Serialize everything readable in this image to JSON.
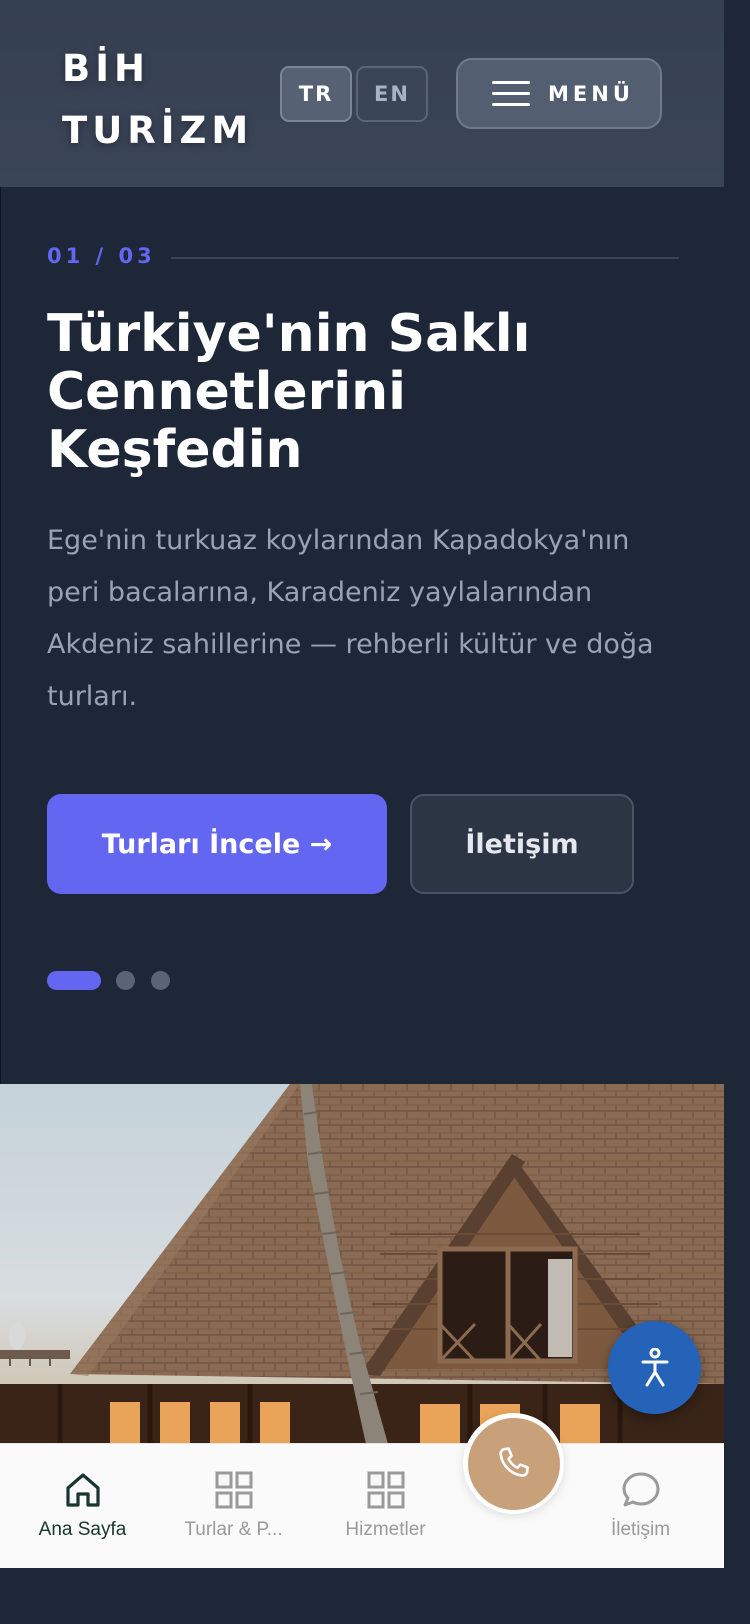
{
  "header": {
    "logo_line1": "BİH",
    "logo_line2": "TURİZM",
    "lang_tr": "TR",
    "lang_en": "EN",
    "menu_label": "MENÜ"
  },
  "hero": {
    "counter": "01 / 03",
    "title_line1": "Türkiye'nin Saklı",
    "title_line2": "Cennetlerini",
    "title_line3": "Keşfedin",
    "description": "Ege'nin turkuaz koylarından Kapadokya'nın peri bacalarına, Karadeniz yaylalarından Akdeniz sahillerine — rehberli kültür ve doğa turları.",
    "primary_button": "Turları İncele →",
    "secondary_button": "İletişim",
    "slide_active": 1,
    "slide_count": 3
  },
  "bottom_nav": {
    "home": "Ana Sayfa",
    "tours": "Turlar & P...",
    "services": "Hizmetler",
    "contact": "İletişim"
  },
  "colors": {
    "accent": "#6366f1",
    "header_bg": "#3b4558",
    "hero_bg": "#1e2738",
    "call_button": "#c8a07a",
    "accessibility_button": "#2563b8",
    "nav_active": "#17362d"
  },
  "icons": {
    "menu": "hamburger-icon",
    "accessibility": "accessibility-icon",
    "home": "home-icon",
    "tours": "grid-icon",
    "services": "grid-icon",
    "call": "phone-icon",
    "contact": "chat-bubble-icon"
  }
}
